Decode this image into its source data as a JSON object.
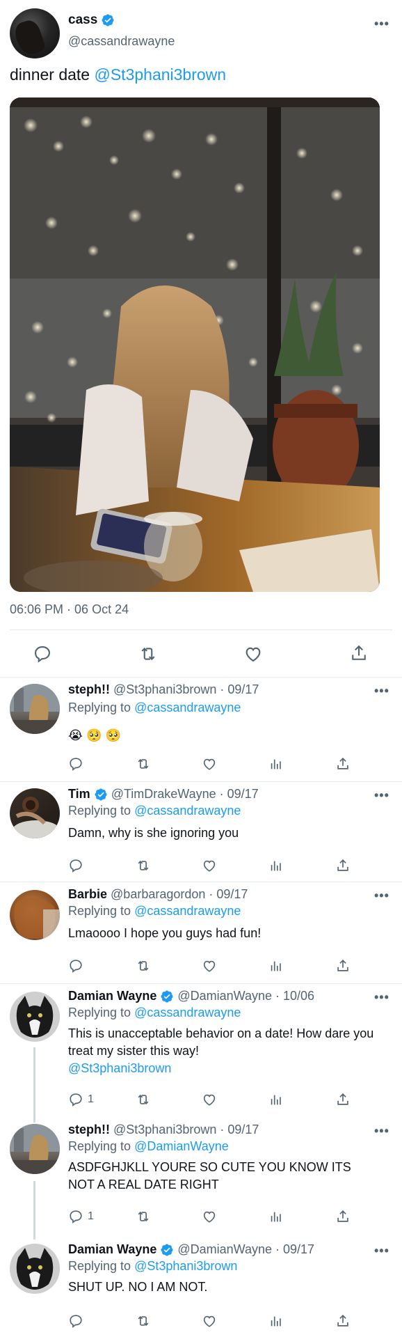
{
  "main_tweet": {
    "name": "cass",
    "handle": "@cassandrawayne",
    "text": "dinner date",
    "mention": "@St3phani3brown",
    "timestamp": "06:06 PM · 06 Oct 24",
    "photo_description_icon": "dinner-photo"
  },
  "replies": [
    {
      "name": "steph!!",
      "handle": "@St3phani3brown · 09/17",
      "verified": false,
      "replying_prefix": "Replying to",
      "replying_to": "@cassandrawayne",
      "text": "😭 🥺 🥺",
      "reply_count": ""
    },
    {
      "name": "Tim",
      "handle": "@TimDrakeWayne · 09/17",
      "verified": true,
      "replying_prefix": "Replying to",
      "replying_to": "@cassandrawayne",
      "text": "Damn, why is she ignoring you",
      "reply_count": ""
    },
    {
      "name": "Barbie",
      "handle": "@barbaragordon · 09/17",
      "verified": false,
      "replying_prefix": "Replying to",
      "replying_to": "@cassandrawayne",
      "text": "Lmaoooo I hope you guys had fun!",
      "reply_count": ""
    },
    {
      "name": "Damian Wayne",
      "handle": "@DamianWayne · 10/06",
      "verified": true,
      "replying_prefix": "Replying to",
      "replying_to": "@cassandrawayne",
      "text": "This is unacceptable behavior on a date! How dare you treat my sister this way!",
      "mention": "@St3phani3brown",
      "reply_count": "1"
    },
    {
      "name": "steph!!",
      "handle": "@St3phani3brown · 09/17",
      "verified": false,
      "replying_prefix": "Replying to",
      "replying_to": "@DamianWayne",
      "text": "ASDFGHJKLL YOURE SO CUTE YOU KNOW ITS NOT A REAL DATE RIGHT",
      "reply_count": "1"
    },
    {
      "name": "Damian Wayne",
      "handle": "@DamianWayne · 09/17",
      "verified": true,
      "replying_prefix": "Replying to",
      "replying_to": "@St3phani3brown",
      "text": "SHUT UP. NO I AM NOT.",
      "reply_count": ""
    }
  ],
  "more_label": "•••",
  "colors": {
    "accent": "#1d9bf0",
    "muted": "#536471",
    "text": "#0f1419"
  }
}
